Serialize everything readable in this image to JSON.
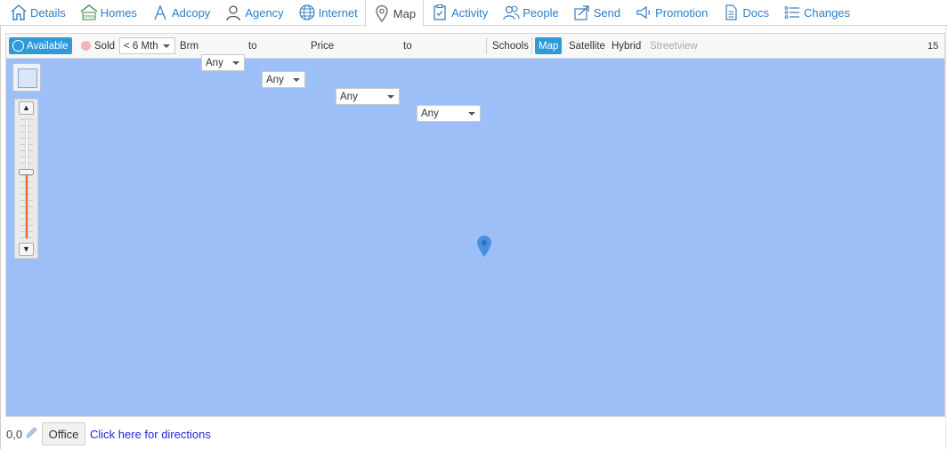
{
  "tabs": [
    {
      "label": "Details",
      "icon": "home-icon"
    },
    {
      "label": "Homes",
      "icon": "open-house-icon",
      "badge": "OPEN"
    },
    {
      "label": "Adcopy",
      "icon": "adcopy-icon"
    },
    {
      "label": "Agency",
      "icon": "person-icon"
    },
    {
      "label": "Internet",
      "icon": "globe-icon"
    },
    {
      "label": "Map",
      "icon": "map-pin-icon",
      "active": true
    },
    {
      "label": "Activity",
      "icon": "clipboard-icon"
    },
    {
      "label": "People",
      "icon": "people-icon"
    },
    {
      "label": "Send",
      "icon": "send-icon"
    },
    {
      "label": "Promotion",
      "icon": "megaphone-icon"
    },
    {
      "label": "Docs",
      "icon": "document-icon"
    },
    {
      "label": "Changes",
      "icon": "list-icon"
    }
  ],
  "toolbar": {
    "available_label": "Available",
    "sold_label": "Sold",
    "period_value": "< 6 Mth",
    "brm_label": "Brm",
    "brm_min_value": "Any",
    "to_label": "to",
    "brm_max_value": "Any",
    "price_label": "Price",
    "price_min_value": "Any",
    "price_max_value": "Any",
    "schools_label": "Schools",
    "map_label": "Map",
    "satellite_label": "Satellite",
    "hybrid_label": "Hybrid",
    "streetview_label": "Streetview",
    "zoom_value": "15"
  },
  "map": {
    "zoom_level_fraction": 0.56,
    "colors": {
      "water": "#9dbff8",
      "pin": "#4a90e2",
      "accent": "#2f9ad8",
      "zoom_fill": "#e2712b"
    }
  },
  "footer": {
    "coordinates": "0,0",
    "office_label": "Office",
    "directions_link": "Click here for directions"
  }
}
